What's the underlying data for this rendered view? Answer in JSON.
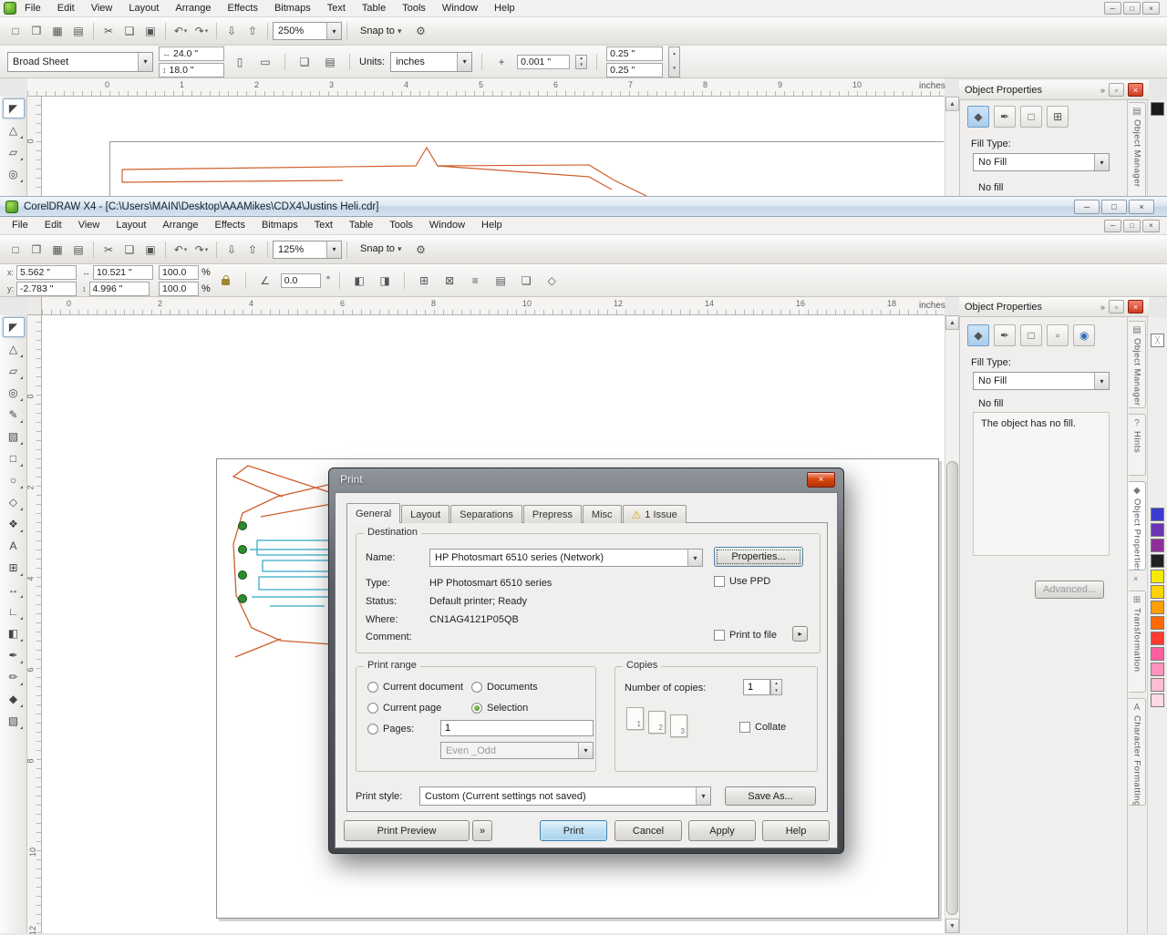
{
  "icons": {
    "new": "□",
    "open": "❒",
    "save": "▦",
    "print": "▤",
    "cut": "✂",
    "copy": "❏",
    "paste": "▣",
    "undo": "↶",
    "redo": "↷",
    "import": "⇩",
    "export": "⇧",
    "gear": "⚙",
    "caret": "▾",
    "up": "▴",
    "down": "▾",
    "min": "─",
    "max": "□",
    "close": "×",
    "chev": "»",
    "fly": "▸",
    "warn": "⚠",
    "hmirror": "◧",
    "vmirror": "◨",
    "angle": "∠",
    "harrow": "↔",
    "varrow": "↕",
    "portrait": "▯",
    "landscape": "▭",
    "diamond": "◆",
    "pen": "✒",
    "rect": "□",
    "dash": "▫",
    "globe": "◉",
    "question": "?",
    "layers": "▤",
    "a": "A",
    "grid": "⊞",
    "box_x": "⊠",
    "lines": "≡",
    "poly": "◇",
    "scroll_up": "▲",
    "scroll_dn": "▼",
    "x_swatch": "╳",
    "plus": "+"
  },
  "tools": [
    {
      "name": "pick-tool",
      "glyph": "◤"
    },
    {
      "name": "shape-tool",
      "glyph": "△"
    },
    {
      "name": "crop-tool",
      "glyph": "▱"
    },
    {
      "name": "zoom-tool",
      "glyph": "◎"
    },
    {
      "name": "freehand-tool",
      "glyph": "✎"
    },
    {
      "name": "smart-fill-tool",
      "glyph": "▨"
    },
    {
      "name": "rectangle-tool",
      "glyph": "□"
    },
    {
      "name": "ellipse-tool",
      "glyph": "○"
    },
    {
      "name": "polygon-tool",
      "glyph": "◇"
    },
    {
      "name": "basic-shapes-tool",
      "glyph": "❖"
    },
    {
      "name": "text-tool",
      "glyph": "A"
    },
    {
      "name": "table-tool",
      "glyph": "⊞"
    },
    {
      "name": "dimension-tool",
      "glyph": "↔"
    },
    {
      "name": "connector-tool",
      "glyph": "∟"
    },
    {
      "name": "blend-tool",
      "glyph": "◧"
    },
    {
      "name": "eyedropper-tool",
      "glyph": "✒"
    },
    {
      "name": "outline-tool",
      "glyph": "✏"
    },
    {
      "name": "fill-tool",
      "glyph": "◆"
    },
    {
      "name": "interactive-fill-tool",
      "glyph": "▧"
    }
  ],
  "bg": {
    "menu": [
      "File",
      "Edit",
      "View",
      "Layout",
      "Arrange",
      "Effects",
      "Bitmaps",
      "Text",
      "Table",
      "Tools",
      "Window",
      "Help"
    ],
    "zoom": "250%",
    "snap": "Snap to",
    "prop": {
      "paper": "Broad Sheet",
      "w": "24.0 \"",
      "h": "18.0 \"",
      "units_label": "Units:",
      "units": "inches",
      "nudge": "0.001 \"",
      "dupx": "0.25 \"",
      "dupy": "0.25 \""
    },
    "ruler": [
      "0",
      "1",
      "2",
      "3",
      "4",
      "5",
      "6",
      "7",
      "8",
      "9",
      "10"
    ],
    "ruler_unit": "inches",
    "vruler": [
      "0"
    ],
    "docker": {
      "title": "Object Properties",
      "fill_type_label": "Fill Type:",
      "fill_type": "No Fill",
      "no_fill": "No fill"
    },
    "side_tab": "Object Manager"
  },
  "fg": {
    "title": "CorelDRAW X4 - [C:\\Users\\MAIN\\Desktop\\AAAMikes\\CDX4\\Justins Heli.cdr]",
    "menu": [
      "File",
      "Edit",
      "View",
      "Layout",
      "Arrange",
      "Effects",
      "Bitmaps",
      "Text",
      "Table",
      "Tools",
      "Window",
      "Help"
    ],
    "zoom": "125%",
    "snap": "Snap to",
    "prop": {
      "x_label": "x:",
      "x": "5.562 \"",
      "y_label": "y:",
      "y": "-2.783 \"",
      "w": "10.521 \"",
      "h": "4.996 \"",
      "sx": "100.0",
      "sy": "100.0",
      "pct": "%",
      "angle": "0.0",
      "deg": "°"
    },
    "ruler": [
      "0",
      "2",
      "4",
      "6",
      "8",
      "10",
      "12",
      "14",
      "16",
      "18"
    ],
    "ruler_unit": "inches",
    "vruler": [
      "0",
      "2",
      "4",
      "6",
      "8",
      "10",
      "12"
    ],
    "docker": {
      "title": "Object Properties",
      "fill_type_label": "Fill Type:",
      "fill_type": "No Fill",
      "no_fill": "No fill",
      "no_fill_desc": "The object has no fill.",
      "advanced": "Advanced..."
    },
    "side_tabs": [
      "Object Manager",
      "Hints",
      "Object Properties",
      "Transformation",
      "Character Formatting"
    ]
  },
  "dialog": {
    "title": "Print",
    "tabs": [
      "General",
      "Layout",
      "Separations",
      "Prepress",
      "Misc"
    ],
    "issue_tab": "1 Issue",
    "destination": {
      "label": "Destination",
      "name_label": "Name:",
      "name": "HP Photosmart 6510 series (Network)",
      "properties": "Properties...",
      "type_label": "Type:",
      "type": "HP Photosmart 6510 series",
      "use_ppd": "Use PPD",
      "status_label": "Status:",
      "status": "Default printer; Ready",
      "where_label": "Where:",
      "where": "CN1AG4121P05QB",
      "comment_label": "Comment:",
      "print_to_file": "Print to file"
    },
    "range": {
      "label": "Print range",
      "current_document": "Current document",
      "documents": "Documents",
      "current_page": "Current page",
      "selection": "Selection",
      "pages_label": "Pages:",
      "pages": "1",
      "even_odd": "Even _Odd"
    },
    "copies": {
      "label": "Copies",
      "num_label": "Number of copies:",
      "num": "1",
      "collate": "Collate",
      "pages": [
        "1",
        "2",
        "3"
      ]
    },
    "style_label": "Print style:",
    "style": "Custom (Current settings not saved)",
    "save_as": "Save As...",
    "buttons": {
      "preview": "Print Preview",
      "print": "Print",
      "cancel": "Cancel",
      "apply": "Apply",
      "help": "Help"
    }
  },
  "palette": [
    "#3b3bd0",
    "#6a35b5",
    "#8c2f9b",
    "#202020",
    "#f2ea00",
    "#ffd300",
    "#ff9e00",
    "#ff6a00",
    "#ff3b30",
    "#ff5f9e",
    "#ff93bd",
    "#ffbcd4",
    "#ffd9e4"
  ],
  "palette_bg": [
    "#1a1a1a"
  ]
}
